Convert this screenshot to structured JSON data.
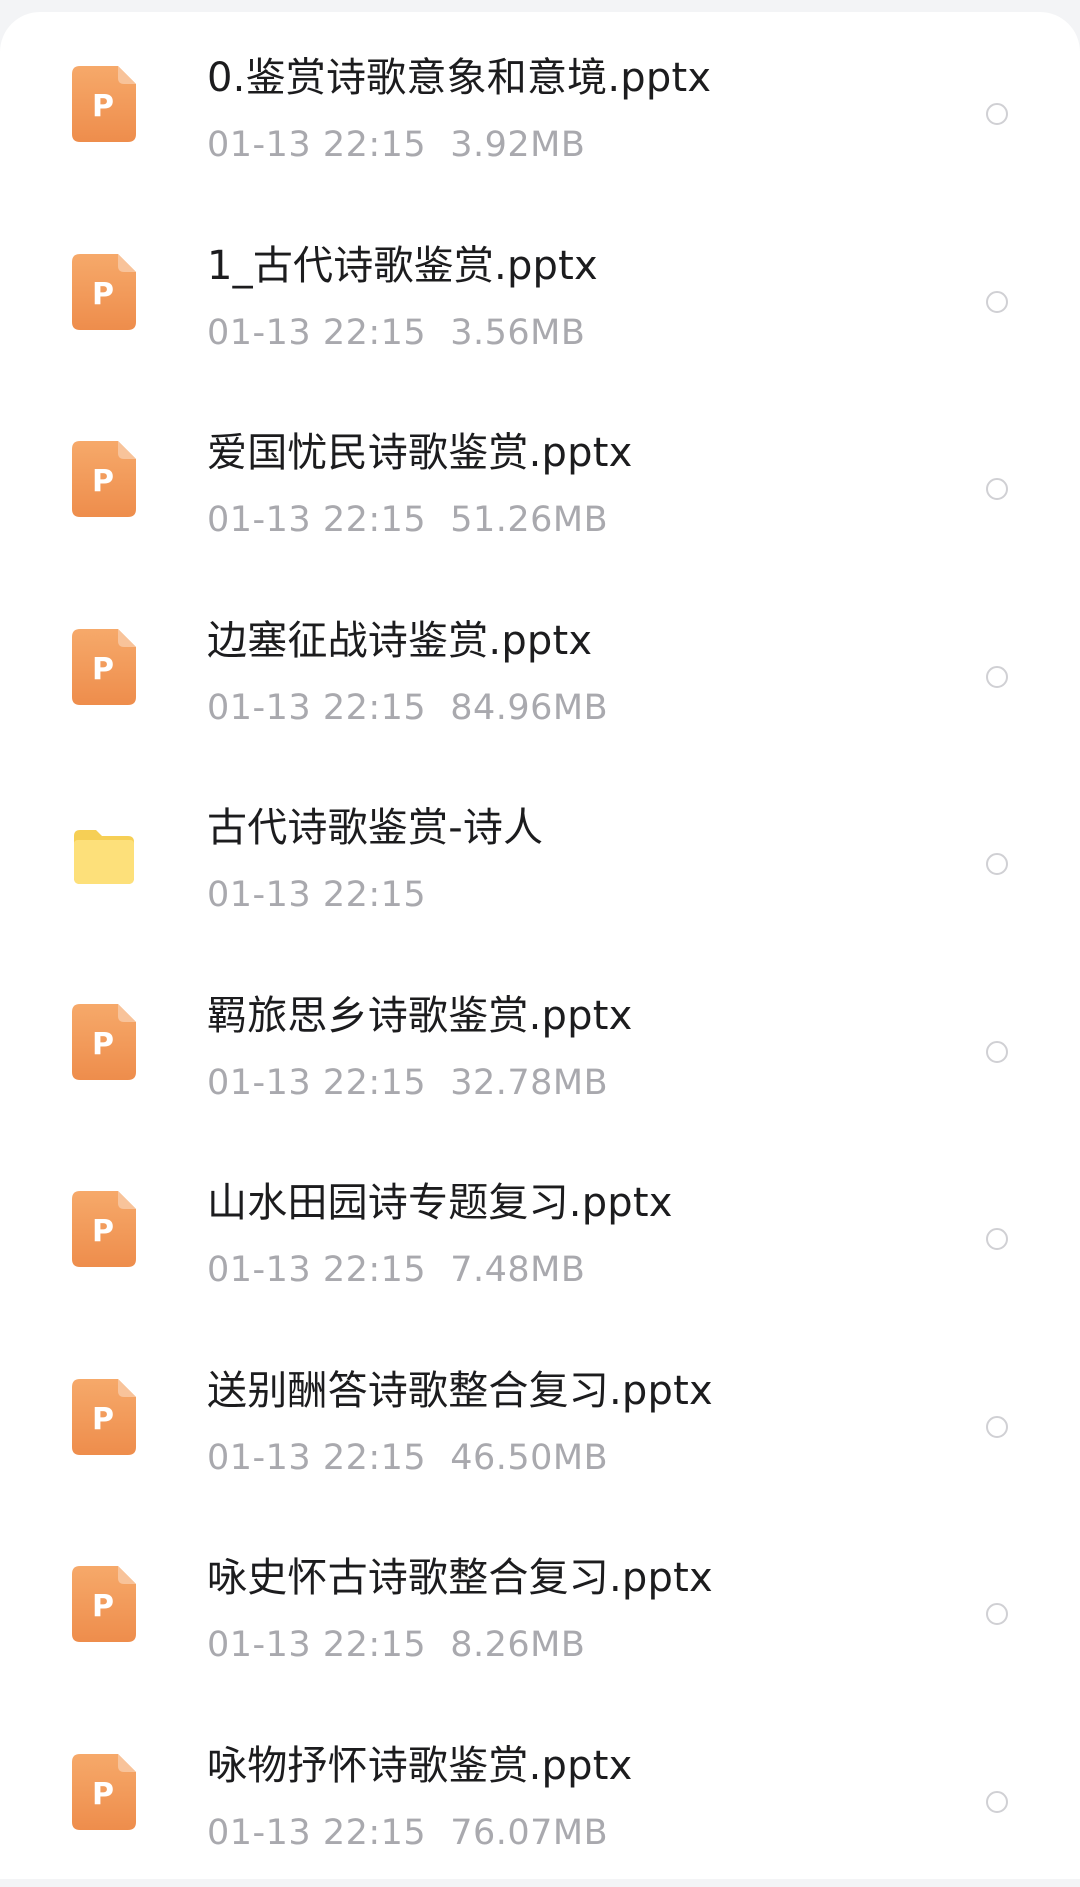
{
  "files": [
    {
      "name": "0.鉴赏诗歌意象和意境.pptx",
      "date": "01-13  22:15",
      "size": "3.92MB",
      "icon": "pptx-icon"
    },
    {
      "name": "1_古代诗歌鉴赏.pptx",
      "date": "01-13  22:15",
      "size": "3.56MB",
      "icon": "pptx-icon"
    },
    {
      "name": "爱国忧民诗歌鉴赏.pptx",
      "date": "01-13  22:15",
      "size": "51.26MB",
      "icon": "pptx-icon"
    },
    {
      "name": "边塞征战诗鉴赏.pptx",
      "date": "01-13  22:15",
      "size": "84.96MB",
      "icon": "pptx-icon"
    },
    {
      "name": "古代诗歌鉴赏-诗人",
      "date": "01-13  22:15",
      "size": "",
      "icon": "folder-icon"
    },
    {
      "name": "羁旅思乡诗歌鉴赏.pptx",
      "date": "01-13  22:15",
      "size": "32.78MB",
      "icon": "pptx-icon"
    },
    {
      "name": "山水田园诗专题复习.pptx",
      "date": "01-13  22:15",
      "size": "7.48MB",
      "icon": "pptx-icon"
    },
    {
      "name": "送别酬答诗歌整合复习.pptx",
      "date": "01-13  22:15",
      "size": "46.50MB",
      "icon": "pptx-icon"
    },
    {
      "name": "咏史怀古诗歌整合复习.pptx",
      "date": "01-13  22:15",
      "size": "8.26MB",
      "icon": "pptx-icon"
    },
    {
      "name": "咏物抒怀诗歌鉴赏.pptx",
      "date": "01-13  22:15",
      "size": "76.07MB",
      "icon": "pptx-icon"
    }
  ],
  "colors": {
    "pptx_icon": "#f29b5a",
    "folder_icon": "#fbd96a",
    "name_text": "#1c1c1e",
    "meta_text": "#a9a9ae",
    "radio_border": "#d0d0d4"
  }
}
